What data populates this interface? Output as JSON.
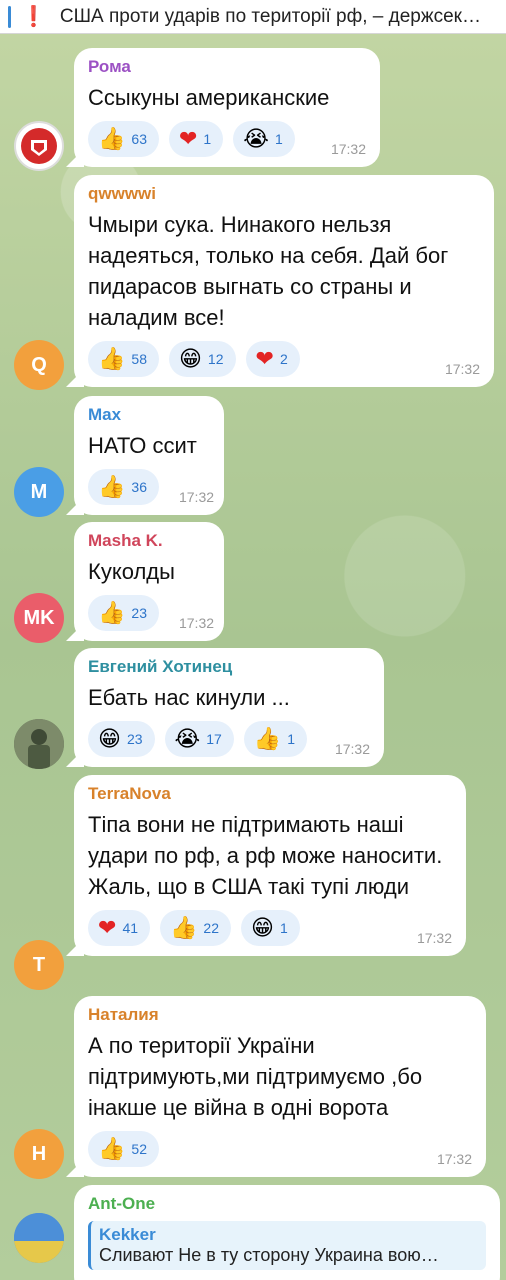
{
  "pinned": {
    "icon": "exclamation-icon",
    "text": "США проти ударів по території рф, – держсек…"
  },
  "messages": [
    {
      "author": "Рома",
      "author_color": "#9c51c4",
      "avatar_text": "",
      "avatar_color": "#ffffff",
      "text": "Ссыкуны американские",
      "reactions": [
        {
          "emoji": "👍",
          "count": "63"
        },
        {
          "emoji": "❤",
          "count": "1"
        },
        {
          "emoji": "😭",
          "count": "1"
        }
      ],
      "time": "17:32"
    },
    {
      "author": "qwwwwi",
      "author_color": "#d8822b",
      "avatar_text": "Q",
      "avatar_color": "#f2a03d",
      "text": "Чмыри сука. Нинакого нельзя надеяться, только на себя. Дай бог пидарасов выгнать со страны и наладим все!",
      "reactions": [
        {
          "emoji": "👍",
          "count": "58"
        },
        {
          "emoji": "😁",
          "count": "12"
        },
        {
          "emoji": "❤",
          "count": "2"
        }
      ],
      "time": "17:32"
    },
    {
      "author": "Max",
      "author_color": "#3a8bd6",
      "avatar_text": "M",
      "avatar_color": "#4a9ee6",
      "text": "НАТО ссит",
      "reactions": [
        {
          "emoji": "👍",
          "count": "36"
        }
      ],
      "time": "17:32"
    },
    {
      "author": "Masha K.",
      "author_color": "#d0455b",
      "avatar_text": "MK",
      "avatar_color": "#ea5d6a",
      "text": "Куколды",
      "reactions": [
        {
          "emoji": "👍",
          "count": "23"
        }
      ],
      "time": "17:32"
    },
    {
      "author": "Евгений Хотинец",
      "author_color": "#2e8fa0",
      "avatar_text": "",
      "avatar_color": "#5a6a55",
      "text": "Ебать нас кинули ...",
      "reactions": [
        {
          "emoji": "😁",
          "count": "23"
        },
        {
          "emoji": "😭",
          "count": "17"
        },
        {
          "emoji": "👍",
          "count": "1"
        }
      ],
      "time": "17:32"
    },
    {
      "author": "TerraNova",
      "author_color": "#d8822b",
      "avatar_text": "T",
      "avatar_color": "#f2a03d",
      "text": "Тіпа вони не підтримають наші удари по рф, а рф може наносити. Жаль, що в США такі тупі люди",
      "reactions": [
        {
          "emoji": "❤",
          "count": "41"
        },
        {
          "emoji": "👍",
          "count": "22"
        },
        {
          "emoji": "😁",
          "count": "1"
        }
      ],
      "time": "17:32"
    },
    {
      "author": "Наталия",
      "author_color": "#d8822b",
      "avatar_text": "H",
      "avatar_color": "#f2a03d",
      "text": "А по території України підтримують,ми підтримуємо ,бо інакше це війна в одні ворота",
      "reactions": [
        {
          "emoji": "👍",
          "count": "52"
        }
      ],
      "time": "17:32"
    },
    {
      "author": "Ant-One",
      "author_color": "#4caf50",
      "avatar_text": "",
      "avatar_color": "#4c8fd8",
      "reply_name": "Kekker",
      "reply_text": "Сливают Не в ту сторону Украина вою…"
    }
  ]
}
